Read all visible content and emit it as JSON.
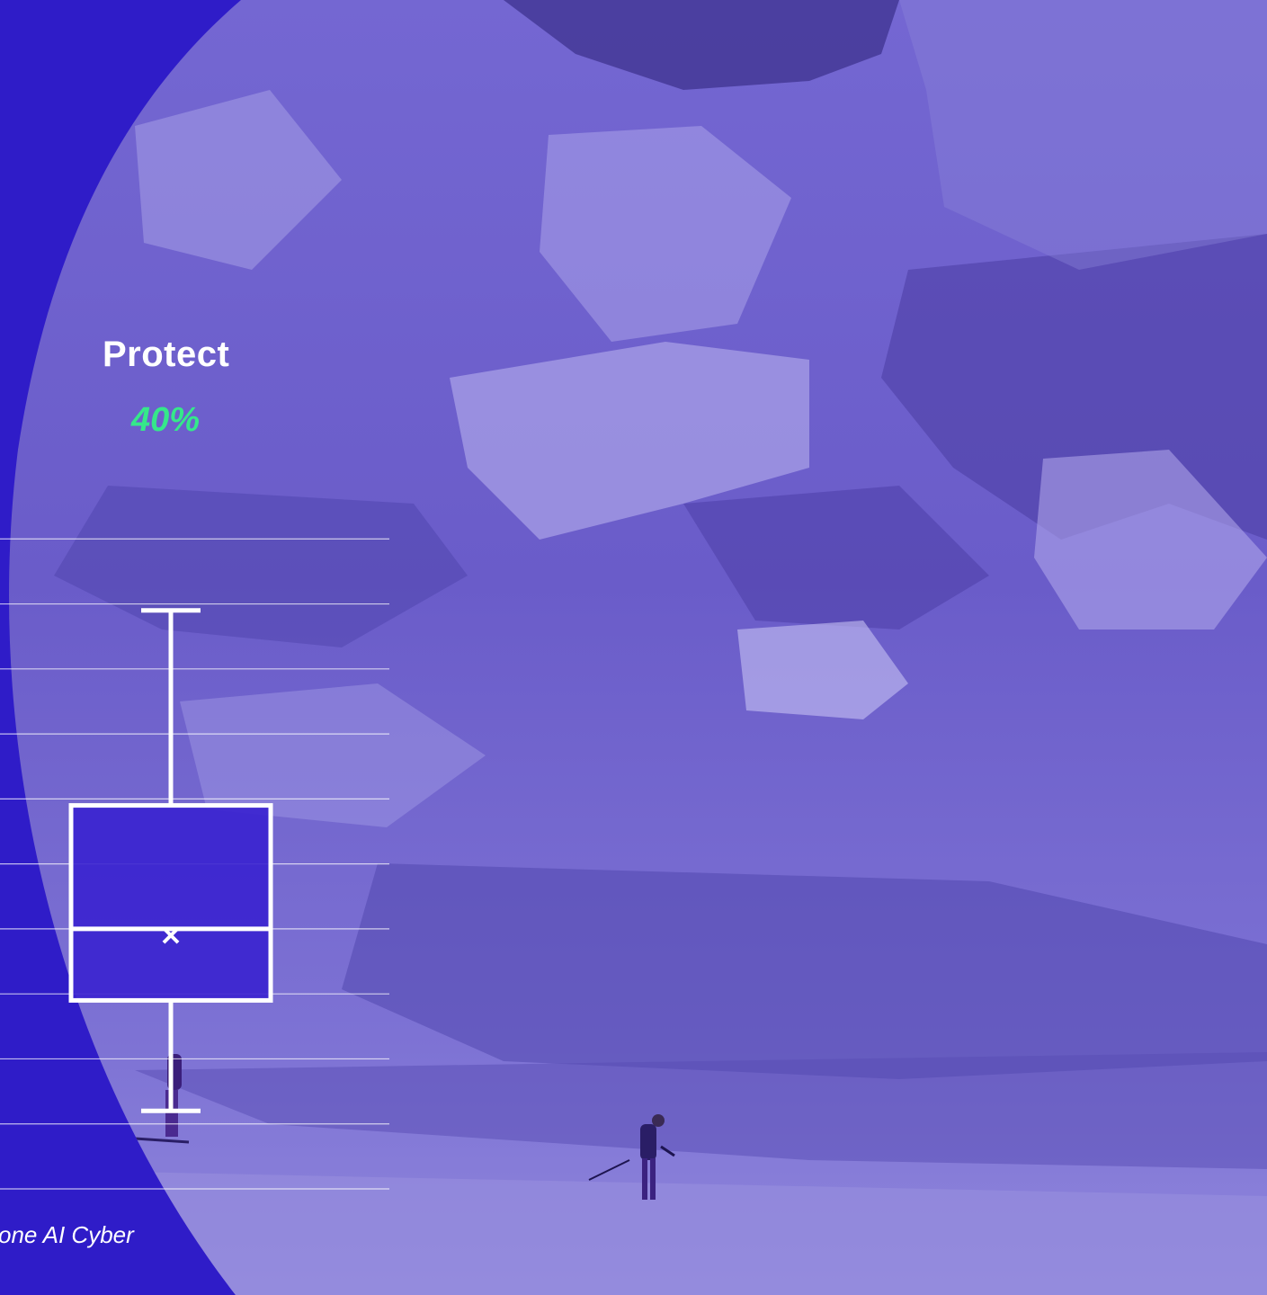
{
  "colors": {
    "panel": "#2f1cc8",
    "photo_tint": "#6558c6",
    "accent_green": "#35e88a",
    "chart_lines": "#ffffff"
  },
  "background": {
    "icon": "glacier-skier-photo"
  },
  "chart_data": {
    "type": "box",
    "title": "Protect",
    "subtitle": "40%",
    "series": [
      {
        "min": 0.1,
        "q1": 0.95,
        "median": 1.5,
        "q3": 2.45,
        "max": 3.95,
        "mean": 1.45
      }
    ],
    "ylim": [
      -0.5,
      5.0
    ],
    "grid": true,
    "gridlines": [
      -0.5,
      0,
      0.5,
      1.0,
      1.5,
      2.0,
      2.5,
      3.0,
      3.5,
      4.0,
      4.5
    ]
  },
  "footer": {
    "source": "one AI Cyber"
  }
}
